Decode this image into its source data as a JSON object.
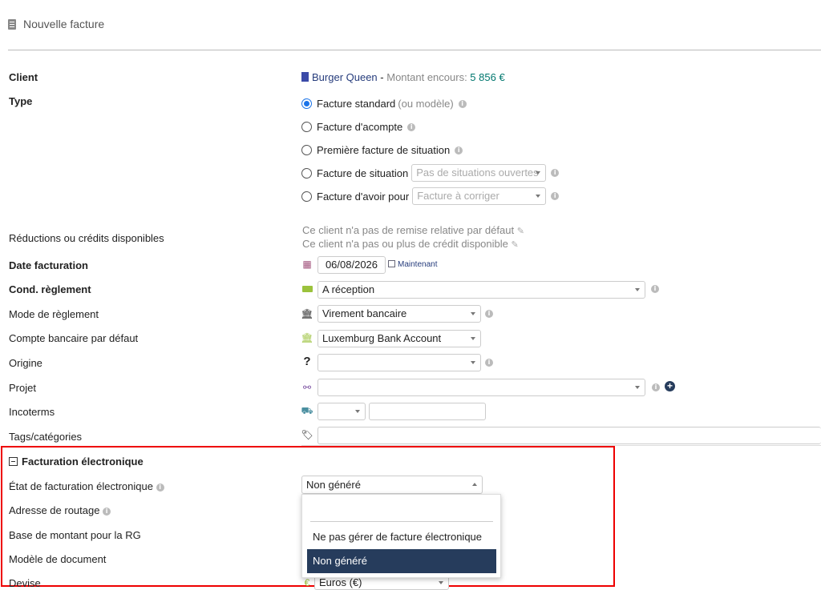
{
  "page": {
    "title": "Nouvelle facture"
  },
  "fields": {
    "client_label": "Client",
    "type_label": "Type",
    "reductions_label": "Réductions ou crédits disponibles",
    "date_label": "Date facturation",
    "cond_label": "Cond. règlement",
    "mode_label": "Mode de règlement",
    "compte_label": "Compte bancaire par défaut",
    "origine_label": "Origine",
    "projet_label": "Projet",
    "incoterms_label": "Incoterms",
    "tags_label": "Tags/catégories"
  },
  "client": {
    "name": "Burger Queen",
    "separator": " - ",
    "encours_label": "Montant encours: ",
    "encours_value": "5 856 €"
  },
  "types": {
    "standard": "Facture standard",
    "standard_hint": "(ou modèle)",
    "acompte": "Facture d'acompte",
    "premiere_situation": "Première facture de situation",
    "situation": "Facture de situation",
    "situation_placeholder": "Pas de situations ouvertes",
    "avoir": "Facture d'avoir pour",
    "avoir_placeholder": "Facture à corriger"
  },
  "reductions": {
    "remise": "Ce client n'a pas de remise relative par défaut",
    "credit": "Ce client n'a pas ou plus de crédit disponible"
  },
  "date": {
    "value": "06/08/2026",
    "now_label": "Maintenant"
  },
  "cond": {
    "value": "A réception"
  },
  "mode": {
    "value": "Virement bancaire"
  },
  "compte": {
    "value": "Luxemburg Bank Account"
  },
  "efact": {
    "section_title": "Facturation électronique",
    "etat_label": "État de facturation électronique",
    "adresse_label": "Adresse de routage",
    "base_label": "Base de montant pour la RG",
    "modele_label": "Modèle de document",
    "devise_label": "Devise",
    "etat_value": "Non généré",
    "devise_value": "Euros (€)"
  },
  "dropdown": {
    "options": [
      "Ne pas gérer de facture électronique",
      "Non généré"
    ],
    "selected": "Non généré"
  },
  "colors": {
    "accent": "#263c5c",
    "highlight": "#e00000",
    "encours": "#00776e",
    "radio": "#1a73e8"
  }
}
